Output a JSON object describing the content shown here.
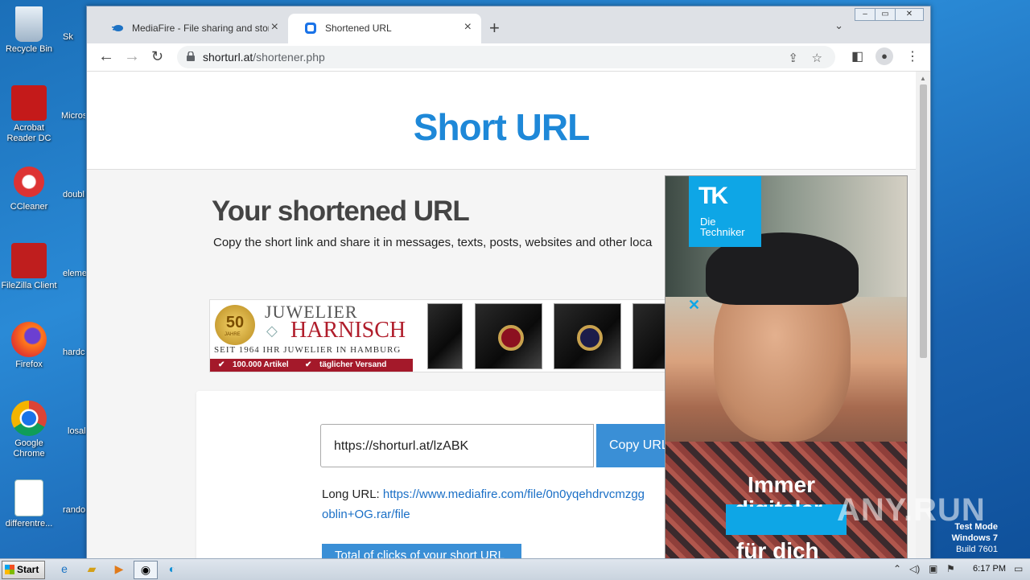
{
  "desktop": {
    "icons": [
      {
        "label": "Recycle Bin",
        "icon": "recycle-bin-icon"
      },
      {
        "label": "Acrobat Reader DC",
        "icon": "acrobat-icon"
      },
      {
        "label": "CCleaner",
        "icon": "ccleaner-icon"
      },
      {
        "label": "FileZilla Client",
        "icon": "filezilla-icon"
      },
      {
        "label": "Firefox",
        "icon": "firefox-icon"
      },
      {
        "label": "Google Chrome",
        "icon": "chrome-icon"
      },
      {
        "label": "differentre...",
        "icon": "word-doc-icon"
      }
    ],
    "partial_icons": [
      "Sk",
      "Micros",
      "doubl",
      "eleme",
      "hardc",
      "losal",
      "rando"
    ]
  },
  "browser": {
    "tabs": [
      {
        "label": "MediaFire - File sharing and storage",
        "icon": "mediafire-icon"
      },
      {
        "label": "Shortened URL",
        "icon": "shorturl-icon"
      }
    ],
    "new_tab": "+",
    "url_host": "shorturl.at",
    "url_path": "/shortener.php"
  },
  "page": {
    "site_title": "Short URL",
    "heading": "Your shortened URL",
    "subtitle": "Copy the short link and share it in messages, texts, posts, websites and other loca",
    "short_url": "https://shorturl.at/lzABK",
    "copy_button": "Copy URL",
    "long_url_label": "Long URL:",
    "long_url_line1": "https://www.mediafire.com/file/0n0yqehdrvcmzgg",
    "long_url_line2": "oblin+OG.rar/file",
    "clicks_button": "Total of clicks of your short URL"
  },
  "banner_ad": {
    "badge_number": "50",
    "badge_text": "JAHRE",
    "brand_top": "JUWELIER",
    "brand": "HARNISCH",
    "since": "SEIT 1964 IHR JUWELIER IN HAMBURG",
    "strip_1": "100.000 Artikel",
    "strip_2": "täglicher Versand"
  },
  "side_ad": {
    "logo_mark": "TK",
    "logo_line1": "Die",
    "logo_line2": "Techniker",
    "close": "✕",
    "line1": "Immer",
    "line2": "digitaler",
    "line3": "für dich"
  },
  "taskbar": {
    "start": "Start",
    "clock": "6:17 PM"
  },
  "watermark": {
    "line1": "Test Mode",
    "line2": "Windows 7",
    "line3": "Build 7601",
    "brand": "ANY.RUN"
  }
}
